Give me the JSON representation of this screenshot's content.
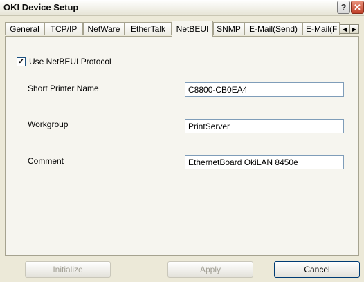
{
  "window": {
    "title": "OKI Device Setup"
  },
  "title_buttons": {
    "help": "?",
    "close": "✕"
  },
  "tabs": [
    {
      "label": "General",
      "active": false
    },
    {
      "label": "TCP/IP",
      "active": false
    },
    {
      "label": "NetWare",
      "active": false
    },
    {
      "label": "EtherTalk",
      "active": false
    },
    {
      "label": "NetBEUI",
      "active": true
    },
    {
      "label": "SNMP",
      "active": false
    },
    {
      "label": "E-Mail(Send)",
      "active": false
    },
    {
      "label": "E-Mail(F",
      "active": false
    }
  ],
  "tab_scroll": {
    "left": "◀",
    "right": "▶"
  },
  "netbeui": {
    "use_protocol_label": "Use NetBEUI Protocol",
    "use_protocol_checked": true,
    "check_mark": "✔",
    "short_printer_name_label": "Short Printer Name",
    "short_printer_name_value": "C8800-CB0EA4",
    "workgroup_label": "Workgroup",
    "workgroup_value": "PrintServer",
    "comment_label": "Comment",
    "comment_value": "EthernetBoard OkiLAN 8450e"
  },
  "buttons": {
    "initialize": "Initialize",
    "apply": "Apply",
    "cancel": "Cancel"
  }
}
